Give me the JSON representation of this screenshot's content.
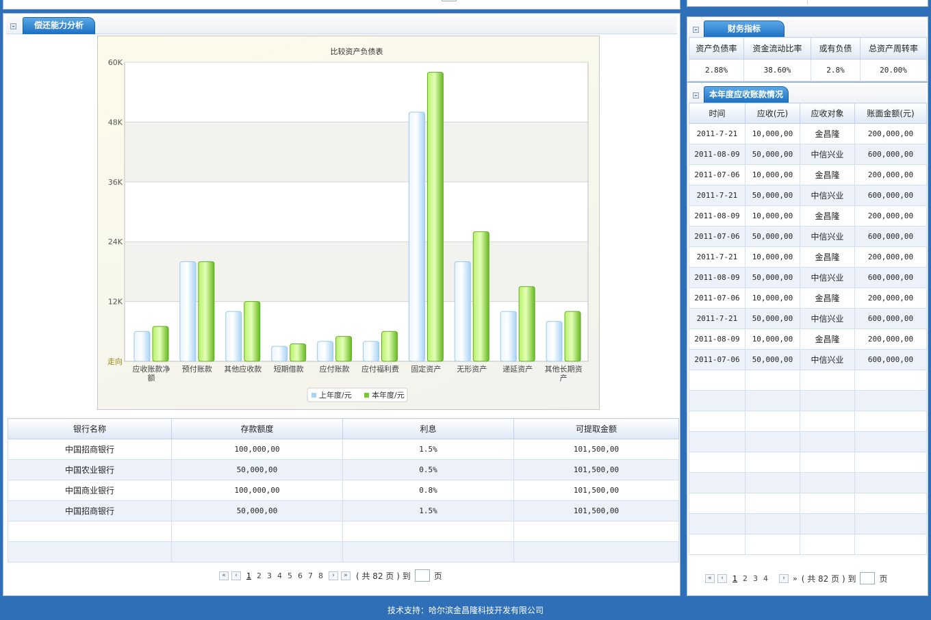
{
  "left_panel": {
    "tab_title": "偿还能力分析"
  },
  "chart_data": {
    "type": "bar",
    "title": "比较资产负债表",
    "categories": [
      "应收账款净额",
      "预付账款",
      "其他应收款",
      "短期借款",
      "应付账款",
      "应付福利费",
      "固定资产",
      "无形资产",
      "递延资产",
      "其他长期资产"
    ],
    "series": [
      {
        "name": "上年度/元",
        "color": "#cfe7fb",
        "values": [
          6000,
          20000,
          10000,
          3000,
          4000,
          4000,
          50000,
          20000,
          10000,
          8000
        ]
      },
      {
        "name": "本年度/元",
        "color": "#8fd13a",
        "values": [
          7000,
          20000,
          12000,
          3500,
          5000,
          6000,
          58000,
          26000,
          15000,
          10000
        ]
      }
    ],
    "ylim": [
      0,
      60000
    ],
    "yticks": [
      "60K",
      "48K",
      "36K",
      "24K",
      "12K"
    ],
    "zero_label": "走向",
    "grid": true,
    "legend": "bottom"
  },
  "bank_table": {
    "headers": [
      "银行名称",
      "存款额度",
      "利息",
      "可提取金额"
    ],
    "rows": [
      [
        "中国招商银行",
        "100,000,00",
        "1.5%",
        "101,500,00"
      ],
      [
        "中国农业银行",
        "50,000,00",
        "0.5%",
        "101,500,00"
      ],
      [
        "中国商业银行",
        "100,000,00",
        "0.8%",
        "101,500,00"
      ],
      [
        "中国招商银行",
        "50,000,00",
        "1.5%",
        "101,500,00"
      ]
    ]
  },
  "left_pager": {
    "first": "«",
    "prev": "‹",
    "next": "›",
    "last": "»",
    "pages": [
      "1",
      "2",
      "3",
      "4",
      "5",
      "6",
      "7",
      "8"
    ],
    "total_text": "( 共 82 页 ) 到",
    "page_suffix": "页"
  },
  "fin_panel": {
    "tab_title": "财务指标",
    "headers": [
      "资产负债率",
      "资金流动比率",
      "或有负债",
      "总资产周转率"
    ],
    "values": [
      "2.88%",
      "38.60%",
      "2.8%",
      "20.00%"
    ]
  },
  "receivable_panel": {
    "tab_title": "本年度应收账款情况",
    "headers": [
      "时间",
      "应收(元)",
      "应收对象",
      "账面金额(元)"
    ],
    "rows": [
      [
        "2011-7-21",
        "10,000,00",
        "金昌隆",
        "200,000,00"
      ],
      [
        "2011-08-09",
        "50,000,00",
        "中信兴业",
        "600,000,00"
      ],
      [
        "2011-07-06",
        "10,000,00",
        "金昌隆",
        "200,000,00"
      ],
      [
        "2011-7-21",
        "50,000,00",
        "中信兴业",
        "600,000,00"
      ],
      [
        "2011-08-09",
        "10,000,00",
        "金昌隆",
        "200,000,00"
      ],
      [
        "2011-07-06",
        "50,000,00",
        "中信兴业",
        "600,000,00"
      ],
      [
        "2011-7-21",
        "10,000,00",
        "金昌隆",
        "200,000,00"
      ],
      [
        "2011-08-09",
        "50,000,00",
        "中信兴业",
        "600,000,00"
      ],
      [
        "2011-07-06",
        "10,000,00",
        "金昌隆",
        "200,000,00"
      ],
      [
        "2011-7-21",
        "50,000,00",
        "中信兴业",
        "600,000,00"
      ],
      [
        "2011-08-09",
        "10,000,00",
        "金昌隆",
        "200,000,00"
      ],
      [
        "2011-07-06",
        "50,000,00",
        "中信兴业",
        "600,000,00"
      ]
    ]
  },
  "right_pager": {
    "first": "«",
    "prev": "‹",
    "next": "›",
    "last": "»",
    "pages": [
      "1",
      "2",
      "3",
      "4"
    ],
    "total_text": "( 共 82 页 ) 到",
    "page_suffix": "页"
  },
  "footer": {
    "text": "技术支持：哈尔滨金昌隆科技开发有限公司"
  },
  "colors": {
    "page_bg": "#2f6fb8",
    "tab_blue": "#1b6fc2",
    "header_row": "#dde8f6",
    "alt_row": "#edf2fa"
  }
}
